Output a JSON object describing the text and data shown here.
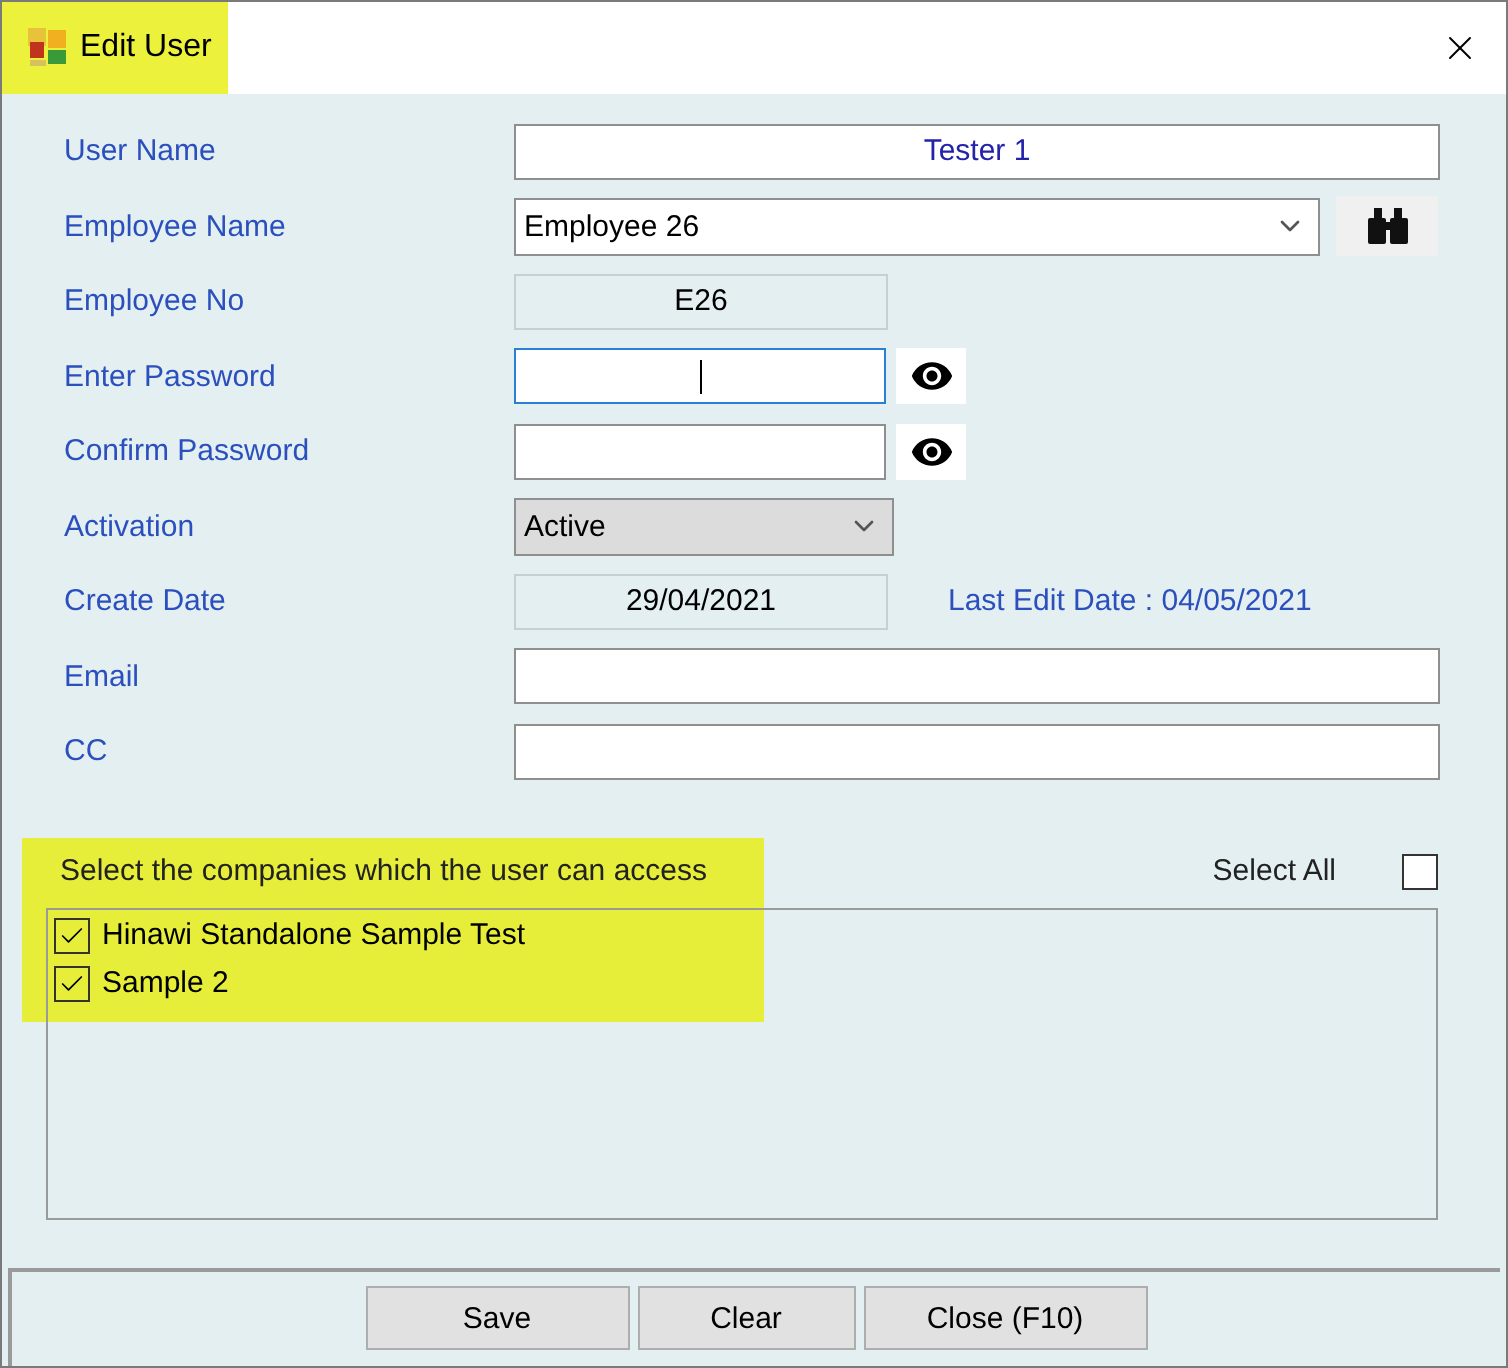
{
  "window": {
    "title": "Edit User",
    "title_highlighted": true
  },
  "fields": [
    {
      "label": "User Name",
      "kind": "text",
      "value": "Tester 1"
    },
    {
      "label": "Employee Name",
      "kind": "combo",
      "value": "Employee 26"
    },
    {
      "label": "Employee No",
      "kind": "readonly",
      "value": "E26"
    },
    {
      "label": "Enter Password",
      "kind": "password",
      "focused": true
    },
    {
      "label": "Confirm Password",
      "kind": "password",
      "focused": false
    },
    {
      "label": "Activation",
      "kind": "select",
      "value": "Active"
    },
    {
      "label": "Create Date",
      "kind": "readonly",
      "value": "29/04/2021",
      "note": "Last Edit Date : 04/05/2021"
    },
    {
      "label": "Email",
      "kind": "text"
    },
    {
      "label": "CC",
      "kind": "text"
    }
  ],
  "companies": {
    "label": "Select the companies which the user can access",
    "highlighted": true,
    "select_all": {
      "label": "Select All",
      "checked": false
    },
    "items": [
      {
        "name": "Hinawi Standalone Sample Test",
        "checked": true
      },
      {
        "name": "Sample 2",
        "checked": true
      }
    ]
  },
  "buttons": [
    "Save",
    "Clear",
    "Close (F10)"
  ]
}
